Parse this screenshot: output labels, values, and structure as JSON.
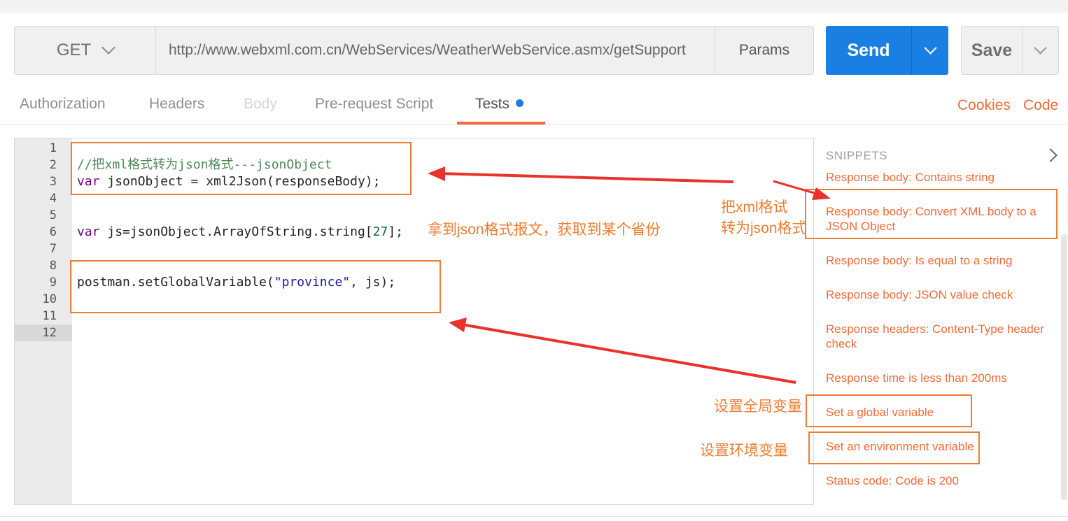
{
  "request": {
    "method": "GET",
    "url": "http://www.webxml.com.cn/WebServices/WeatherWebService.asmx/getSupport",
    "params_label": "Params",
    "send_label": "Send",
    "save_label": "Save"
  },
  "tabs": [
    {
      "label": "Authorization",
      "state": "normal"
    },
    {
      "label": "Headers",
      "state": "normal"
    },
    {
      "label": "Body",
      "state": "disabled"
    },
    {
      "label": "Pre-request Script",
      "state": "normal"
    },
    {
      "label": "Tests",
      "state": "active"
    }
  ],
  "links": {
    "cookies": "Cookies",
    "code": "Code"
  },
  "editor": {
    "line_numbers": [
      "1",
      "2",
      "3",
      "4",
      "5",
      "6",
      "7",
      "8",
      "9",
      "10",
      "11",
      "12"
    ],
    "current_line": "12",
    "lines": {
      "comment": "//把xml格式转为json格式---jsonObject",
      "l3_kw": "var",
      "l3_rest": " jsonObject = xml2Json(responseBody);",
      "l6_kw": "var",
      "l6_a": " js=jsonObject.ArrayOfString.string[",
      "l6_num": "27",
      "l6_b": "];",
      "l9_a": "postman.setGlobalVariable(",
      "l9_str": "\"province\"",
      "l9_b": ", js);"
    }
  },
  "snippets": {
    "heading": "SNIPPETS",
    "items": [
      "Response body: Contains string",
      "Response body: Convert XML body to a JSON Object",
      "Response body: Is equal to a string",
      "Response body: JSON value check",
      "Response headers: Content-Type header check",
      "Response time is less than 200ms",
      "Set a global variable",
      "Set an environment variable",
      "Status code: Code is 200"
    ]
  },
  "annotations": {
    "get_province": "拿到json格式报文，获取到某个省份",
    "xml_to_json_1": "把xml格试",
    "xml_to_json_2": "转为json格式",
    "set_global": "设置全局变量",
    "set_env": "设置环境变量"
  },
  "colors": {
    "accent": "#f26b3a",
    "send_blue": "#1a7fe2",
    "annotation_orange": "#ed7d31",
    "arrow_red": "#e8322b"
  }
}
